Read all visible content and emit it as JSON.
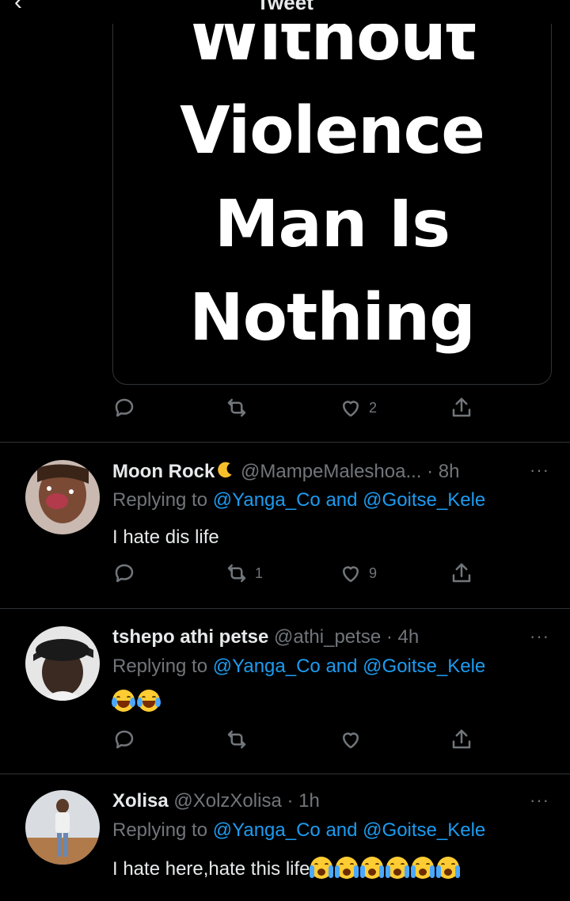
{
  "header": {
    "back_glyph": "‹",
    "title": "Tweet"
  },
  "main_tweet": {
    "media_lines": [
      "Without",
      "Violence",
      "Man Is",
      "Nothing"
    ],
    "actions": {
      "reply_count": "",
      "retweet_count": "",
      "like_count": "2"
    }
  },
  "replies": [
    {
      "display_name": "Moon Rock",
      "name_emoji": "crescent-moon",
      "handle": "@MampeMaleshoa...",
      "time": "· 8h",
      "more": "···",
      "replying_prefix": "Replying to",
      "mention_1": "@Yanga_Co",
      "and_word": "and",
      "mention_2": "@Goitse_Kele",
      "text": "I hate dis life",
      "emojis": [],
      "retweet_count": "1",
      "like_count": "9"
    },
    {
      "display_name": "tshepo athi petse",
      "handle": "@athi_petse",
      "time": "· 4h",
      "more": "···",
      "replying_prefix": "Replying to",
      "mention_1": "@Yanga_Co",
      "and_word": "and",
      "mention_2": "@Goitse_Kele",
      "text": "",
      "emojis": [
        "tears-of-joy",
        "tears-of-joy"
      ],
      "retweet_count": "",
      "like_count": ""
    },
    {
      "display_name": "Xolisa",
      "handle": "@XolzXolisa",
      "time": "· 1h",
      "more": "···",
      "replying_prefix": "Replying to",
      "mention_1": "@Yanga_Co",
      "and_word": "and",
      "mention_2": "@Goitse_Kele",
      "text": "I hate here,hate this life",
      "emojis": [
        "loudly-crying",
        "loudly-crying",
        "loudly-crying",
        "loudly-crying",
        "loudly-crying",
        "loudly-crying"
      ]
    }
  ],
  "colors": {
    "background": "#000000",
    "text": "#e7e9ea",
    "secondary": "#71767b",
    "link": "#1d9bf0",
    "divider": "#2f3336"
  }
}
